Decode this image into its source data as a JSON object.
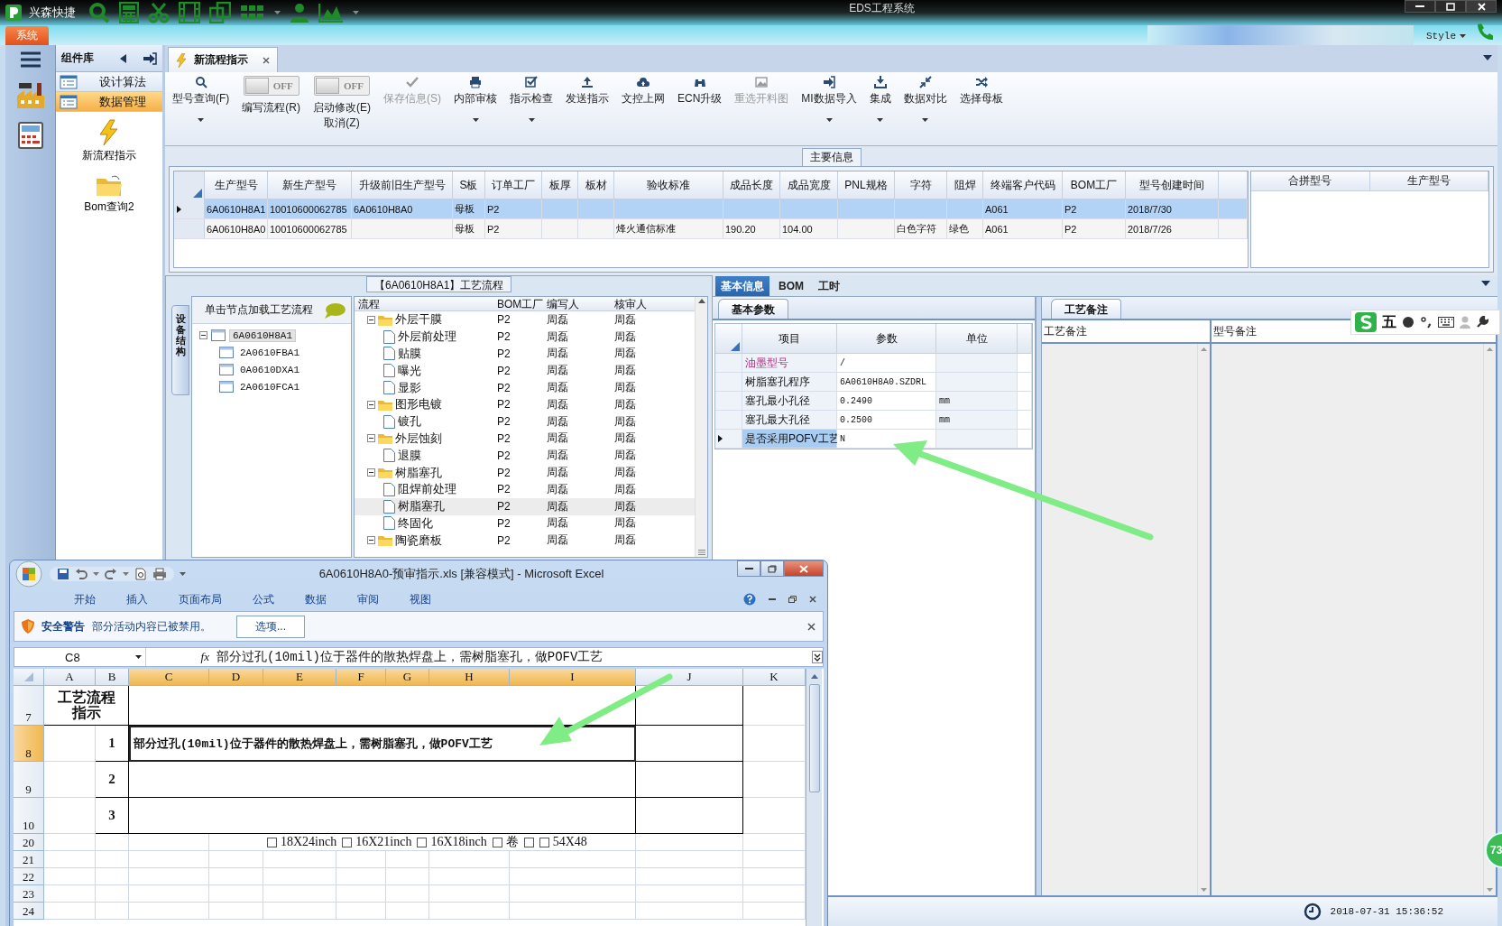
{
  "titlebar": {
    "app_name": "兴森快捷",
    "title": "EDS工程系统"
  },
  "menubar": {
    "system_tab": "系统",
    "style_menu": "Style"
  },
  "component_panel": {
    "title": "组件库",
    "items": [
      {
        "label": "设计算法",
        "selected": false
      },
      {
        "label": "数据管理",
        "selected": true
      }
    ],
    "tiles": [
      {
        "label": "新流程指示",
        "kind": "lightning"
      },
      {
        "label": "Bom查询2",
        "kind": "folder"
      }
    ]
  },
  "doc_tabs": [
    {
      "label": "新流程指示",
      "selected": true
    }
  ],
  "ribbon": [
    {
      "kind": "button",
      "label": "型号查询(F)",
      "disabled": false,
      "dropdown": true
    },
    {
      "kind": "toggle",
      "state_text": "OFF",
      "on": false,
      "label": "编写流程(R)"
    },
    {
      "kind": "toggle",
      "state_text": "OFF",
      "on": false,
      "label": "启动修改(E)",
      "label_line2": "取消(Z)"
    },
    {
      "kind": "button",
      "label": "保存信息(S)",
      "disabled": true,
      "dropdown": false
    },
    {
      "kind": "button",
      "label": "内部审核",
      "disabled": false,
      "dropdown": true
    },
    {
      "kind": "button",
      "label": "指示检查",
      "disabled": false,
      "dropdown": true
    },
    {
      "kind": "button",
      "label": "发送指示",
      "disabled": false,
      "dropdown": false
    },
    {
      "kind": "button",
      "label": "文控上网",
      "disabled": false,
      "dropdown": false
    },
    {
      "kind": "button",
      "label": "ECN升级",
      "disabled": false,
      "dropdown": false
    },
    {
      "kind": "button",
      "label": "重选开料图",
      "disabled": true,
      "dropdown": false
    },
    {
      "kind": "button",
      "label": "MI数据导入",
      "disabled": false,
      "dropdown": true
    },
    {
      "kind": "button",
      "label": "集成",
      "disabled": false,
      "dropdown": true
    },
    {
      "kind": "button",
      "label": "数据对比",
      "disabled": false,
      "dropdown": true
    },
    {
      "kind": "button",
      "label": "选择母板",
      "disabled": false,
      "dropdown": false
    }
  ],
  "main_info": {
    "title": "主要信息",
    "columns": [
      "生产型号",
      "新生产型号",
      "升级前旧生产型号",
      "S板",
      "订单工厂",
      "板厚",
      "板材",
      "验收标准",
      "成品长度",
      "成品宽度",
      "PNL规格",
      "字符",
      "阻焊",
      "终端客户代码",
      "BOM工厂",
      "型号创建时间"
    ],
    "rows": [
      {
        "selected": true,
        "cells": [
          "6A0610H8A1",
          "10010600062785",
          "6A0610H8A0",
          "母板",
          "P2",
          null,
          null,
          null,
          null,
          null,
          null,
          null,
          null,
          "A061",
          "P2",
          "2018/7/30"
        ]
      },
      {
        "selected": false,
        "cells": [
          "6A0610H8A0",
          "10010600062785",
          null,
          "母板",
          "P2",
          null,
          null,
          "烽火通信标准",
          "190.20",
          "104.00",
          null,
          "白色字符",
          "绿色",
          "A061",
          "P2",
          "2018/7/26"
        ]
      }
    ],
    "side_columns": [
      "合拼型号",
      "生产型号"
    ]
  },
  "flow_panel": {
    "title": "【6A0610H8A1】工艺流程",
    "side_tab": "设备结构",
    "structure": {
      "hint": "单击节点加载工艺流程",
      "tree": [
        {
          "label": "6A0610H8A1",
          "selected": true,
          "expanded": true,
          "children": [
            {
              "label": "2A0610FBA1",
              "selected": false
            },
            {
              "label": "0A0610DXA1",
              "selected": false
            },
            {
              "label": "2A0610FCA1",
              "selected": false
            }
          ]
        }
      ]
    },
    "flow": {
      "columns": [
        "流程",
        "BOM工厂",
        "编写人",
        "核审人"
      ],
      "rows": [
        {
          "kind": "group",
          "label": "外层干膜",
          "bom": "P2",
          "writer": "周磊",
          "reviewer": "周磊",
          "expanded": true,
          "children": [
            {
              "kind": "step",
              "label": "外层前处理",
              "bom": "P2",
              "writer": "周磊",
              "reviewer": "周磊",
              "selected": false
            },
            {
              "kind": "step",
              "label": "贴膜",
              "bom": "P2",
              "writer": "周磊",
              "reviewer": "周磊",
              "selected": false
            },
            {
              "kind": "step",
              "label": "曝光",
              "bom": "P2",
              "writer": "周磊",
              "reviewer": "周磊",
              "selected": false
            },
            {
              "kind": "step",
              "label": "显影",
              "bom": "P2",
              "writer": "周磊",
              "reviewer": "周磊",
              "selected": false
            }
          ]
        },
        {
          "kind": "group",
          "label": "图形电镀",
          "bom": "P2",
          "writer": "周磊",
          "reviewer": "周磊",
          "expanded": true,
          "children": [
            {
              "kind": "step",
              "label": "镀孔",
              "bom": "P2",
              "writer": "周磊",
              "reviewer": "周磊",
              "selected": false
            }
          ]
        },
        {
          "kind": "group",
          "label": "外层蚀刻",
          "bom": "P2",
          "writer": "周磊",
          "reviewer": "周磊",
          "expanded": true,
          "children": [
            {
              "kind": "step",
              "label": "退膜",
              "bom": "P2",
              "writer": "周磊",
              "reviewer": "周磊",
              "selected": false
            }
          ]
        },
        {
          "kind": "group",
          "label": "树脂塞孔",
          "bom": "P2",
          "writer": "周磊",
          "reviewer": "周磊",
          "expanded": true,
          "children": [
            {
              "kind": "step",
              "label": "阻焊前处理",
              "bom": "P2",
              "writer": "周磊",
              "reviewer": "周磊",
              "selected": false
            },
            {
              "kind": "step",
              "label": "树脂塞孔",
              "bom": "P2",
              "writer": "周磊",
              "reviewer": "周磊",
              "selected": true
            },
            {
              "kind": "step",
              "label": "终固化",
              "bom": "P2",
              "writer": "周磊",
              "reviewer": "周磊",
              "selected": false
            }
          ]
        },
        {
          "kind": "group",
          "label": "陶瓷磨板",
          "bom": "P2",
          "writer": "周磊",
          "reviewer": "周磊",
          "expanded": true
        }
      ]
    }
  },
  "details": {
    "tabs": [
      {
        "label": "基本信息",
        "selected": true
      },
      {
        "label": "BOM",
        "selected": false
      },
      {
        "label": "工时",
        "selected": false
      }
    ],
    "params": {
      "tab": "基本参数",
      "columns": [
        "项目",
        "参数",
        "单位"
      ],
      "rows": [
        {
          "item": "油墨型号",
          "value": "/",
          "unit": null,
          "emphasized": true,
          "current": false
        },
        {
          "item": "树脂塞孔程序",
          "value": "6A0610H8A0.SZDRL",
          "unit": null,
          "emphasized": false,
          "current": false
        },
        {
          "item": "塞孔最小孔径",
          "value": "0.2490",
          "unit": "mm",
          "emphasized": false,
          "current": false
        },
        {
          "item": "塞孔最大孔径",
          "value": "0.2500",
          "unit": "mm",
          "emphasized": false,
          "current": false
        },
        {
          "item": "是否采用POFV工艺",
          "value": "N",
          "unit": null,
          "emphasized": false,
          "current": true
        }
      ]
    },
    "notes": {
      "tab": "工艺备注",
      "columns": [
        "工艺备注",
        "型号备注"
      ]
    }
  },
  "ime_toolbar": {
    "mode": "五"
  },
  "badge": "73",
  "status_bar": {
    "datetime": "2018-07-31 15:36:52"
  },
  "excel": {
    "title": "6A0610H8A0-预审指示.xls  [兼容模式] - Microsoft Excel",
    "ribbon_tabs": [
      "开始",
      "插入",
      "页面布局",
      "公式",
      "数据",
      "审阅",
      "视图"
    ],
    "security": {
      "title": "安全警告",
      "message": "部分活动内容已被禁用。",
      "button": "选项..."
    },
    "name_box": "C8",
    "function_label": "fx",
    "formula": "部分过孔(10mil)位于器件的散热焊盘上，需树脂塞孔，做POFV工艺",
    "columns": [
      {
        "label": "A",
        "selected": false
      },
      {
        "label": "B",
        "selected": false
      },
      {
        "label": "C",
        "selected": true
      },
      {
        "label": "D",
        "selected": true
      },
      {
        "label": "E",
        "selected": true
      },
      {
        "label": "F",
        "selected": true
      },
      {
        "label": "G",
        "selected": true
      },
      {
        "label": "H",
        "selected": true
      },
      {
        "label": "I",
        "selected": true
      },
      {
        "label": "J",
        "selected": false
      },
      {
        "label": "K",
        "selected": false
      }
    ],
    "rows": [
      {
        "number": "7",
        "kind": "title",
        "selected": false,
        "text": "工艺流程指示"
      },
      {
        "number": "8",
        "kind": "item",
        "selected": true,
        "index": "1",
        "text": "部分过孔(10mil)位于器件的散热焊盘上，需树脂塞孔，做POFV工艺"
      },
      {
        "number": "9",
        "kind": "item",
        "selected": false,
        "index": "2"
      },
      {
        "number": "10",
        "kind": "item",
        "selected": false,
        "index": "3"
      },
      {
        "number": "20",
        "kind": "options",
        "selected": false,
        "options": [
          {
            "label": "18X24inch",
            "checked": false
          },
          {
            "label": "16X21inch",
            "checked": false
          },
          {
            "label": "16X18inch",
            "checked": false
          },
          {
            "label": "卷",
            "checked": false
          },
          {
            "checked": false
          },
          {
            "label": "54X48",
            "checked": false
          }
        ]
      },
      {
        "number": "21",
        "kind": "empty",
        "selected": false
      },
      {
        "number": "22",
        "kind": "empty",
        "selected": false
      },
      {
        "number": "23",
        "kind": "empty",
        "selected": false
      },
      {
        "number": "24",
        "kind": "empty",
        "selected": false
      }
    ]
  }
}
